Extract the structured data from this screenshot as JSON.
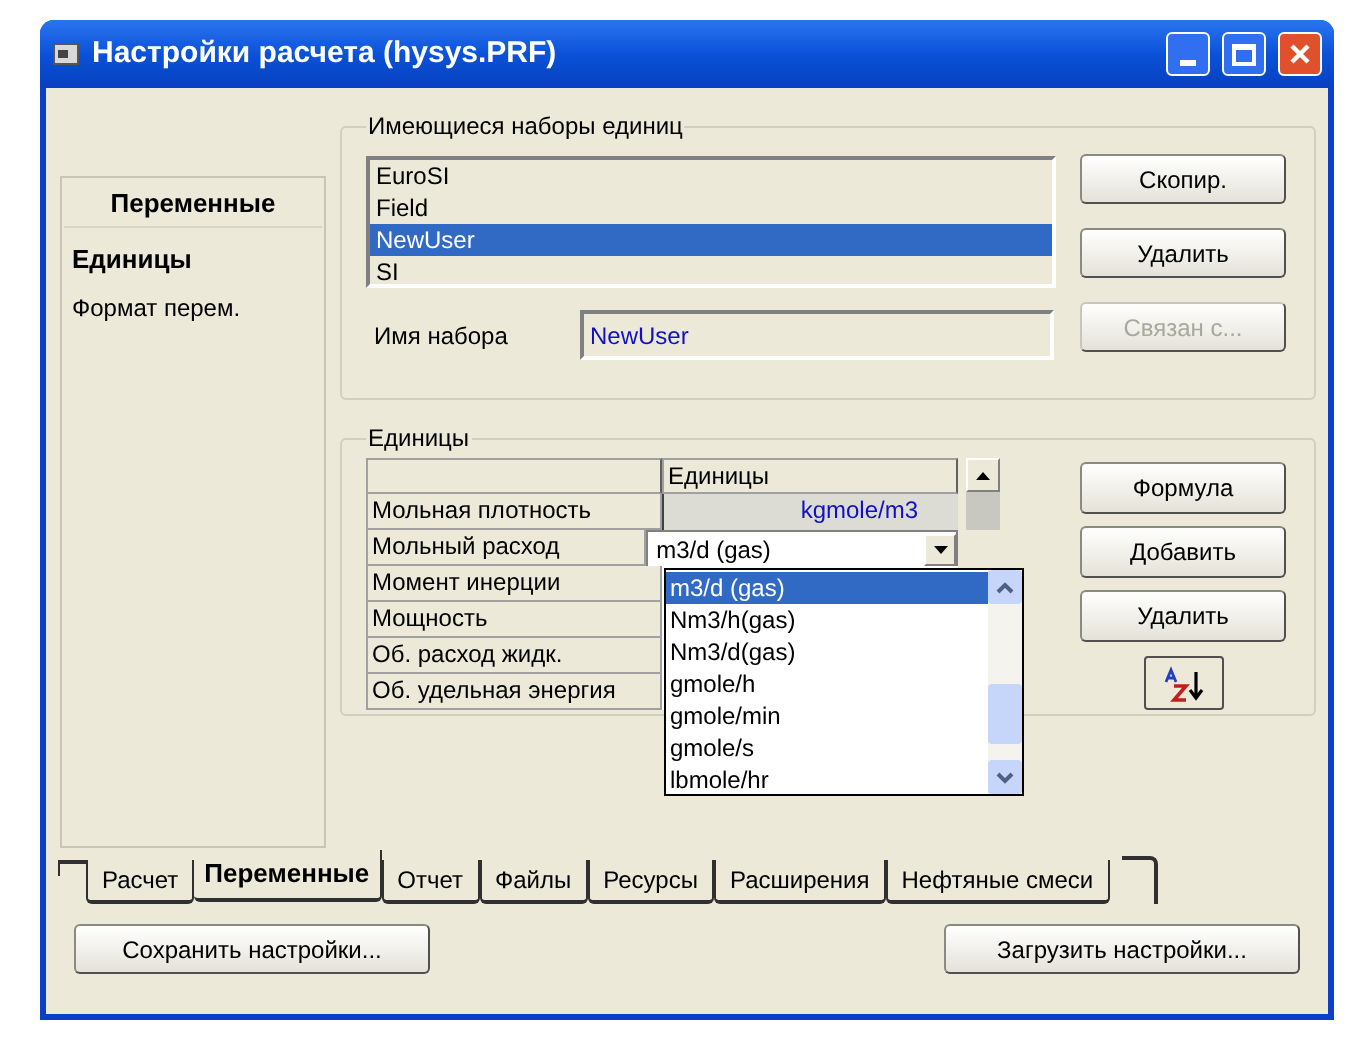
{
  "window": {
    "title": "Настройки расчета (hysys.PRF)"
  },
  "sidebar": {
    "header": "Переменные",
    "items": [
      {
        "label": "Единицы",
        "selected": true
      },
      {
        "label": "Формат перем.",
        "selected": false
      }
    ]
  },
  "unit_sets": {
    "title": "Имеющиеся наборы единиц",
    "items": [
      {
        "label": "EuroSI",
        "selected": false
      },
      {
        "label": "Field",
        "selected": false
      },
      {
        "label": "NewUser",
        "selected": true
      },
      {
        "label": "SI",
        "selected": false
      }
    ],
    "name_label": "Имя набора",
    "name_value": "NewUser",
    "buttons": [
      {
        "label": "Скопир.",
        "disabled": false
      },
      {
        "label": "Удалить",
        "disabled": false
      },
      {
        "label": "Связан с...",
        "disabled": true
      }
    ]
  },
  "units": {
    "title": "Единицы",
    "column": "Единицы",
    "rows": [
      {
        "name": "Мольная плотность",
        "kind": "value",
        "unit": "kgmole/m3"
      },
      {
        "name": "Мольный расход",
        "kind": "combo",
        "unit": "m3/d  (gas)"
      },
      {
        "name": "Момент инерции",
        "kind": "covered"
      },
      {
        "name": "Мощность",
        "kind": "covered"
      },
      {
        "name": "Об. расход жидк.",
        "kind": "covered"
      },
      {
        "name": "Об. удельная энергия",
        "kind": "covered"
      }
    ],
    "dropdown": [
      {
        "label": "m3/d  (gas)",
        "selected": true
      },
      {
        "label": "Nm3/h(gas)",
        "selected": false
      },
      {
        "label": "Nm3/d(gas)",
        "selected": false
      },
      {
        "label": "gmole/h",
        "selected": false
      },
      {
        "label": "gmole/min",
        "selected": false
      },
      {
        "label": "gmole/s",
        "selected": false
      },
      {
        "label": "lbmole/hr",
        "selected": false
      }
    ],
    "buttons": [
      {
        "label": "Формула"
      },
      {
        "label": "Добавить"
      },
      {
        "label": "Удалить"
      }
    ]
  },
  "tabs": [
    {
      "label": "Расчет",
      "selected": false
    },
    {
      "label": "Переменные",
      "selected": true
    },
    {
      "label": "Отчет",
      "selected": false
    },
    {
      "label": "Файлы",
      "selected": false
    },
    {
      "label": "Ресурсы",
      "selected": false
    },
    {
      "label": "Расширения",
      "selected": false
    },
    {
      "label": "Нефтяные смеси",
      "selected": false
    }
  ],
  "footer_buttons": [
    "Сохранить настройки...",
    "Загрузить настройки..."
  ]
}
